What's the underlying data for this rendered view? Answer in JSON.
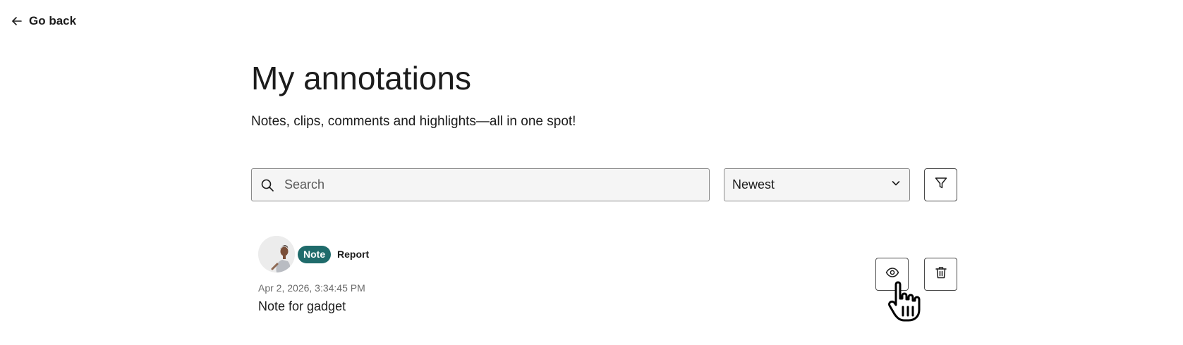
{
  "nav": {
    "back_label": "Go back"
  },
  "header": {
    "title": "My annotations",
    "subtitle": "Notes, clips, comments and highlights—all in one spot!"
  },
  "toolbar": {
    "search_placeholder": "Search",
    "search_value": "",
    "sort_selected": "Newest"
  },
  "annotations": [
    {
      "type": "Note",
      "category": "Report",
      "date": "Apr 2, 2026, 3:34:45 PM",
      "text": "Note for gadget"
    }
  ],
  "colors": {
    "badge_background": "#1f6b6b",
    "input_background": "#f5f5f5",
    "text": "#1c1c1c",
    "muted_text": "#6a6a6a"
  },
  "icons": {
    "back": "arrow-left-icon",
    "search": "search-icon",
    "sort": "chevron-down-icon",
    "filter": "filter-icon",
    "view": "eye-icon",
    "delete": "trash-icon",
    "cursor": "hand-pointer-icon"
  }
}
